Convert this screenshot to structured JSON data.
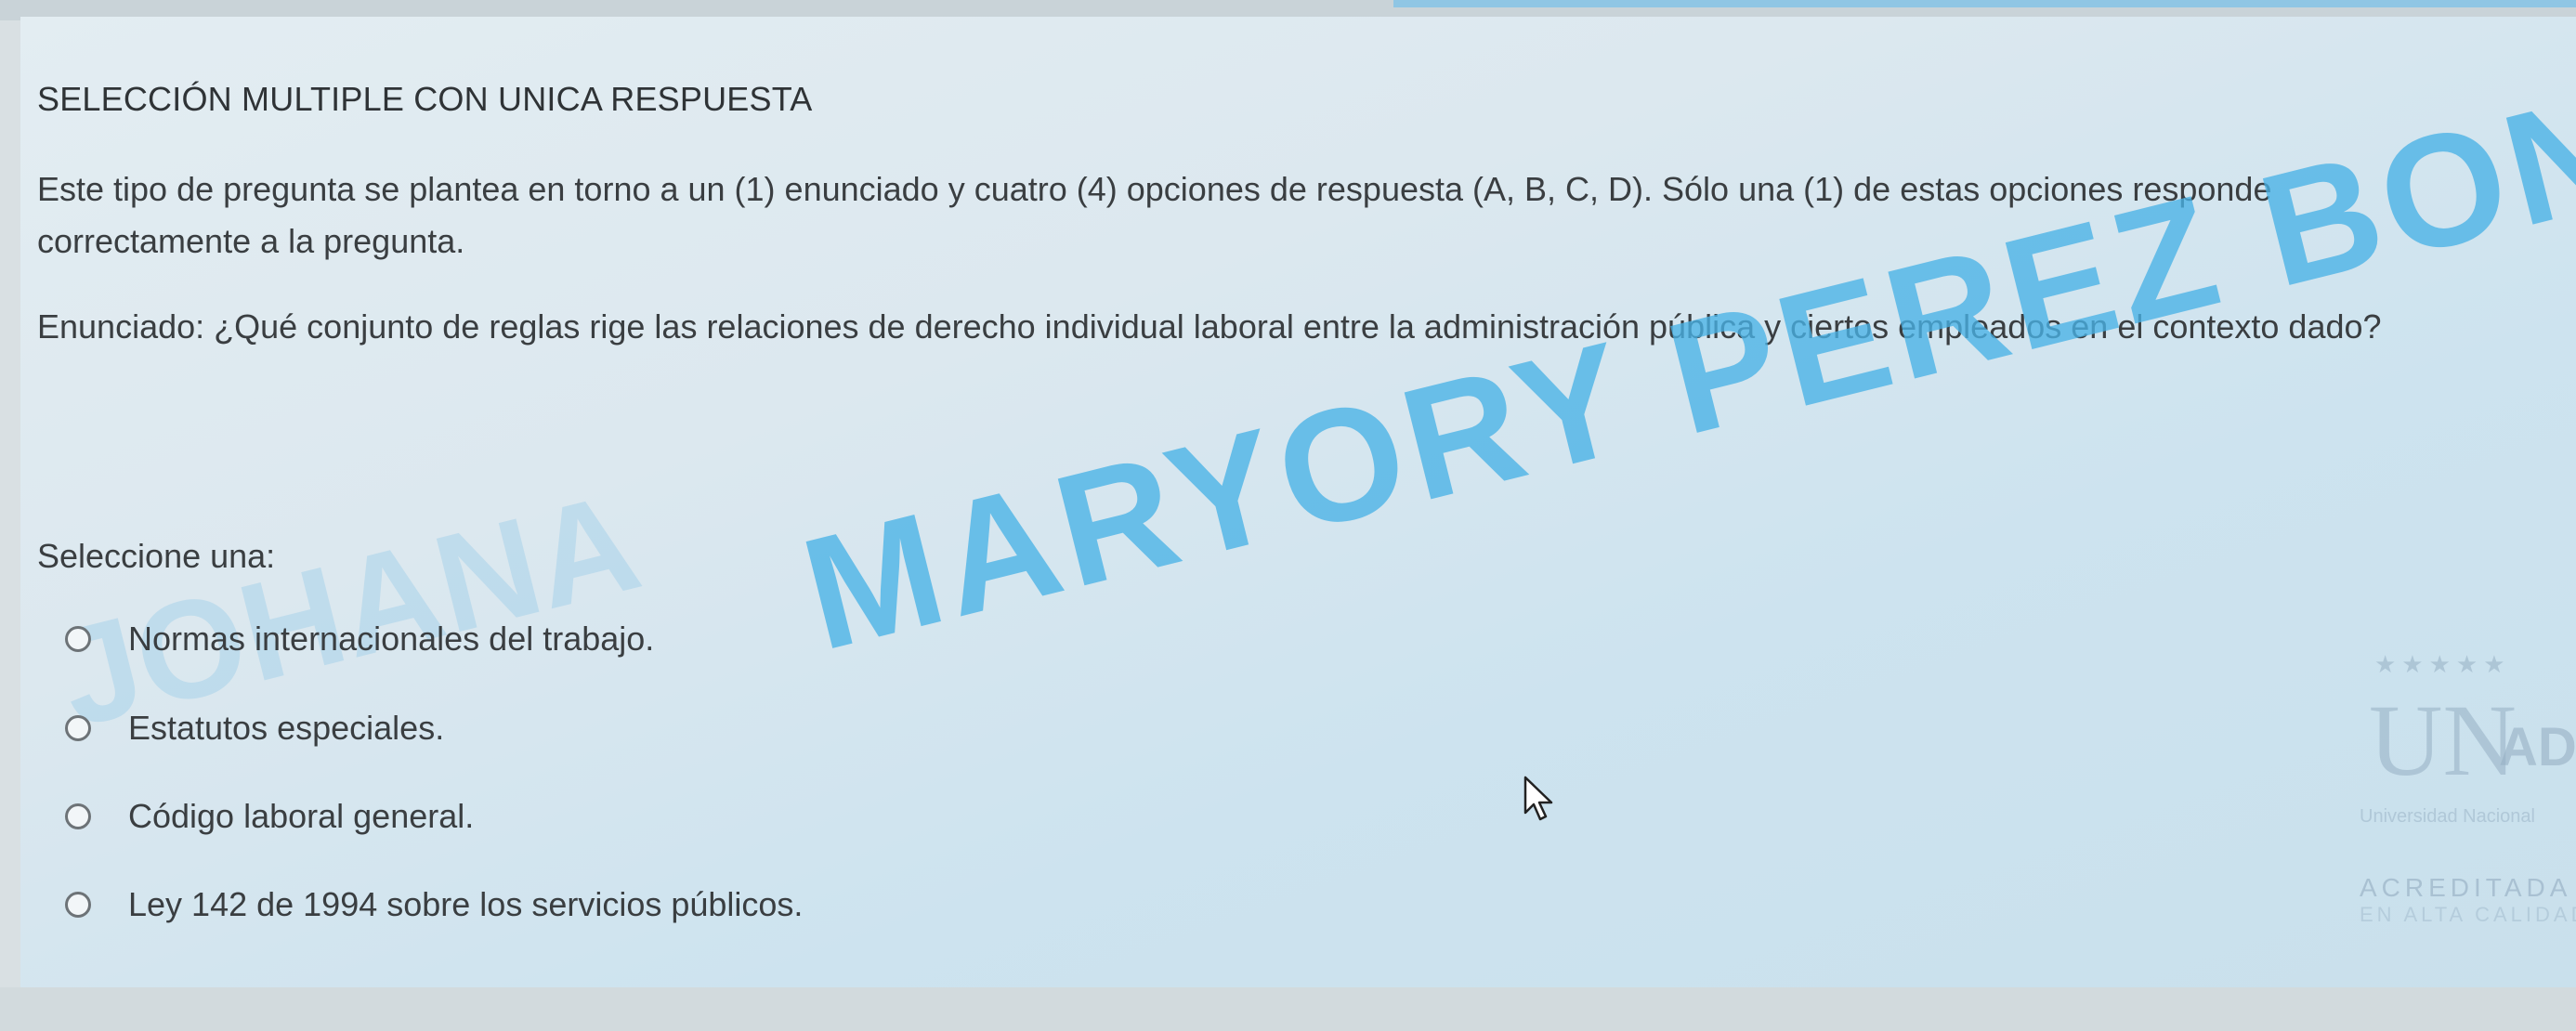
{
  "question": {
    "heading": "SELECCIÓN MULTIPLE CON UNICA RESPUESTA",
    "intro": "Este tipo de pregunta se plantea en torno a un (1) enunciado y cuatro (4) opciones de respuesta (A, B, C, D). Sólo una (1) de estas opciones responde correctamente a la pregunta.",
    "statement": "Enunciado: ¿Qué conjunto de reglas rige las relaciones de derecho individual laboral entre la administración pública y ciertos empleados en el contexto dado?",
    "select_label": "Seleccione una:",
    "options": [
      {
        "label": "Normas internacionales del trabajo.",
        "selected": false
      },
      {
        "label": "Estatutos especiales.",
        "selected": false
      },
      {
        "label": "Código laboral general.",
        "selected": false
      },
      {
        "label": "Ley 142 de 1994 sobre los servicios públicos.",
        "selected": false
      }
    ]
  },
  "watermark": {
    "text": "MARYORY PEREZ BONZA",
    "left_text": "JOHANA",
    "color": "#49b2e6"
  },
  "logo": {
    "un": "UN",
    "ad": "AD",
    "university": "Universidad Nacional",
    "accredited": "ACREDITADA",
    "quality": "EN ALTA CALIDAD"
  },
  "icons": {
    "cursor": "mouse-pointer-icon",
    "radio": "radio-button-icon"
  }
}
